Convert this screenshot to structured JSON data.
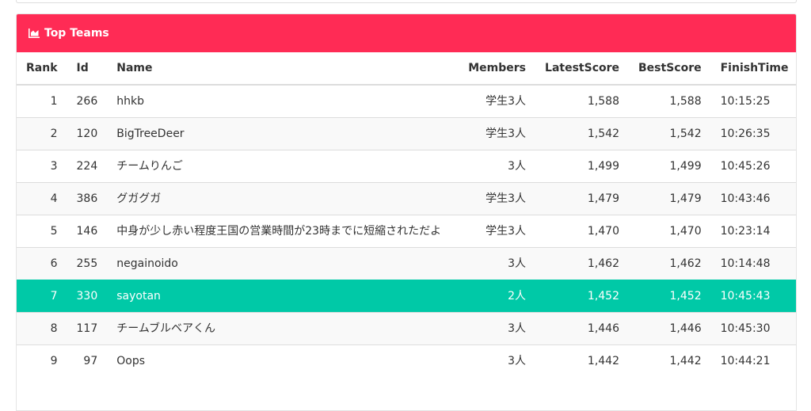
{
  "panel": {
    "title": "Top Teams",
    "heading_color": "#ff2b55",
    "highlight_color": "#00c9a7",
    "icon": "area-chart-icon"
  },
  "table": {
    "headers": {
      "rank": "Rank",
      "id": "Id",
      "name": "Name",
      "members": "Members",
      "latest": "LatestScore",
      "best": "BestScore",
      "finish": "FinishTime"
    },
    "rows": [
      {
        "rank": "1",
        "id": "266",
        "name": "hhkb",
        "members": "学生3人",
        "latest": "1,588",
        "best": "1,588",
        "finish": "10:15:25"
      },
      {
        "rank": "2",
        "id": "120",
        "name": "BigTreeDeer",
        "members": "学生3人",
        "latest": "1,542",
        "best": "1,542",
        "finish": "10:26:35"
      },
      {
        "rank": "3",
        "id": "224",
        "name": "チームりんご",
        "members": "3人",
        "latest": "1,499",
        "best": "1,499",
        "finish": "10:45:26"
      },
      {
        "rank": "4",
        "id": "386",
        "name": "グガグガ",
        "members": "学生3人",
        "latest": "1,479",
        "best": "1,479",
        "finish": "10:43:46"
      },
      {
        "rank": "5",
        "id": "146",
        "name": "中身が少し赤い程度王国の営業時間が23時までに短縮されただよ",
        "members": "学生3人",
        "latest": "1,470",
        "best": "1,470",
        "finish": "10:23:14"
      },
      {
        "rank": "6",
        "id": "255",
        "name": "negainoido",
        "members": "3人",
        "latest": "1,462",
        "best": "1,462",
        "finish": "10:14:48"
      },
      {
        "rank": "7",
        "id": "330",
        "name": "sayotan",
        "members": "2人",
        "latest": "1,452",
        "best": "1,452",
        "finish": "10:45:43",
        "highlighted": true
      },
      {
        "rank": "8",
        "id": "117",
        "name": "チームブルベアくん",
        "members": "3人",
        "latest": "1,446",
        "best": "1,446",
        "finish": "10:45:30"
      },
      {
        "rank": "9",
        "id": "97",
        "name": "Oops",
        "members": "3人",
        "latest": "1,442",
        "best": "1,442",
        "finish": "10:44:21"
      }
    ]
  }
}
